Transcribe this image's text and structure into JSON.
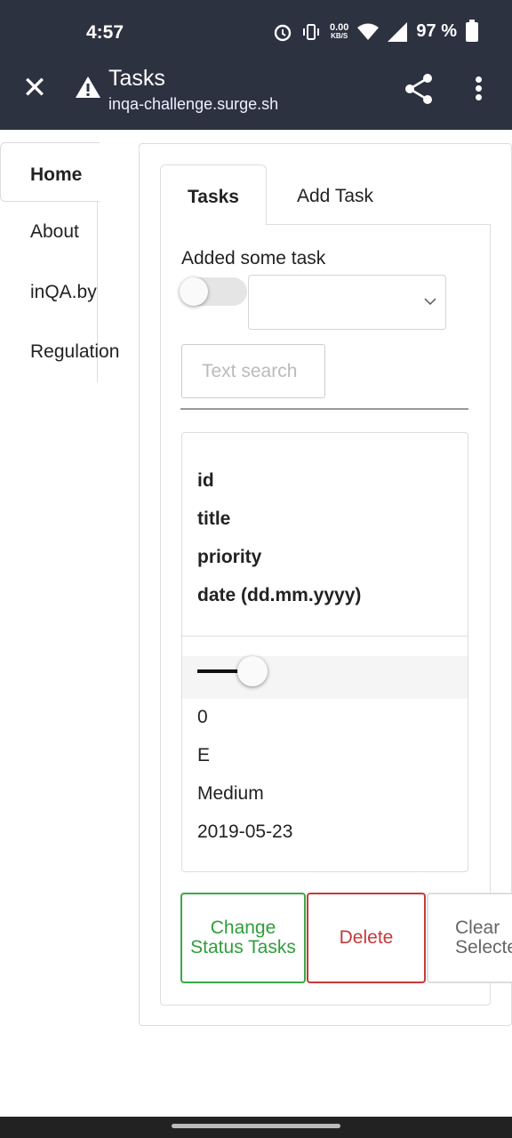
{
  "status_bar": {
    "time": "4:57",
    "speed_value": "0.00",
    "speed_unit": "KB/S",
    "battery": "97 %",
    "icons": [
      "alarm-icon",
      "vibrate-icon",
      "wifi-icon",
      "signal-icon",
      "battery-icon"
    ]
  },
  "app_bar": {
    "title": "Tasks",
    "url": "inqa-challenge.surge.sh",
    "icons": [
      "close-icon",
      "warning-icon",
      "share-icon",
      "more-vert-icon"
    ]
  },
  "sidenav": {
    "items": [
      {
        "label": "Home",
        "active": true
      },
      {
        "label": "About"
      },
      {
        "label": "inQA.by"
      },
      {
        "label": "Regulation"
      }
    ]
  },
  "tabs": {
    "items": [
      {
        "label": "Tasks",
        "active": true
      },
      {
        "label": "Add Task"
      }
    ]
  },
  "filters": {
    "toggle_label": "Added some task",
    "toggle_on": false,
    "select_value": "",
    "search_placeholder": "Text search"
  },
  "table": {
    "headers": [
      "id",
      "title",
      "priority",
      "date (dd.mm.yyyy)"
    ],
    "rows": [
      {
        "id": "0",
        "title": "E",
        "priority": "Medium",
        "date": "2019-05-23"
      }
    ]
  },
  "actions": {
    "change_status": "Change Status Tasks",
    "delete": "Delete",
    "clear_selected": "Clear Selected"
  },
  "colors": {
    "topbar": "#2d3241",
    "success": "#3aaa45",
    "danger": "#c43a3a"
  }
}
